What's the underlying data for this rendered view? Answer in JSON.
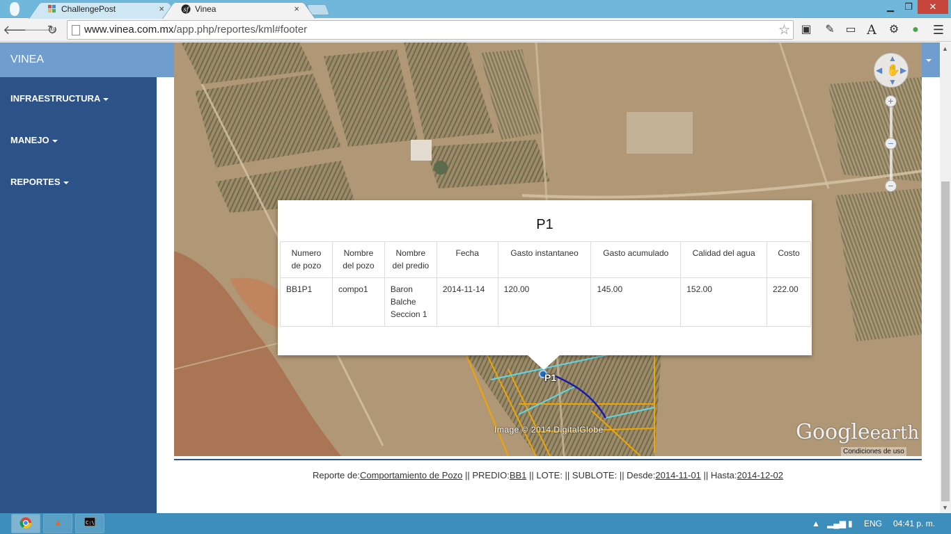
{
  "browser": {
    "tabs": [
      {
        "title": "ChallengePost",
        "icon": "challengepost-icon"
      },
      {
        "title": "Vinea",
        "icon": "symfony-icon",
        "active": true
      }
    ],
    "url_host": "www.vinea.com.mx",
    "url_path": "/app.php/reportes/kml#footer"
  },
  "sidebar": {
    "brand": "VINEA",
    "items": [
      {
        "label": "INFRAESTRUCTURA"
      },
      {
        "label": "MANEJO"
      },
      {
        "label": "REPORTES"
      }
    ]
  },
  "map": {
    "credit": "Image © 2014 DigitalGlobe",
    "logo_main": "Google",
    "logo_sub": "earth",
    "terms": "Condiciones de uso",
    "pin_label": "P1"
  },
  "balloon": {
    "title": "P1",
    "headers": [
      "Numero de pozo",
      "Nombre del pozo",
      "Nombre del predio",
      "Fecha",
      "Gasto instantaneo",
      "Gasto acumulado",
      "Calidad del agua",
      "Costo"
    ],
    "row": [
      "BB1P1",
      "compo1",
      "Baron Balche Seccion 1",
      "2014-11-14",
      "120.00",
      "145.00",
      "152.00",
      "222.00"
    ]
  },
  "footer": {
    "label_reporte": "Reporte de:",
    "reporte": "Comportamiento de Pozo",
    "label_predio": " || PREDIO:",
    "predio": "BB1",
    "label_rest": " || LOTE: || SUBLOTE: || Desde:",
    "desde": "2014-11-01",
    "label_hasta": " || Hasta:",
    "hasta": "2014-12-02"
  },
  "taskbar": {
    "lang": "ENG",
    "clock": "04:41 p. m."
  }
}
